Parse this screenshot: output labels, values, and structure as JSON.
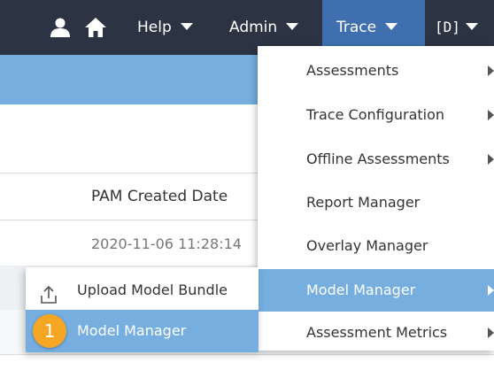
{
  "nav": {
    "icons": [
      "user-icon",
      "home-icon"
    ],
    "help_label": "Help",
    "admin_label": "Admin",
    "trace_label": "Trace",
    "user_badge": "[D]"
  },
  "table": {
    "column_header": "PAM Created Date",
    "row_value": "2020-11-06 11:28:14"
  },
  "trace_menu": {
    "items": [
      {
        "label": "Assessments",
        "has_submenu": true
      },
      {
        "label": "Trace Configuration",
        "has_submenu": true
      },
      {
        "label": "Offline Assessments",
        "has_submenu": true
      },
      {
        "label": "Report Manager",
        "has_submenu": false
      },
      {
        "label": "Overlay Manager",
        "has_submenu": false
      },
      {
        "label": "Model Manager",
        "has_submenu": true,
        "active": true
      },
      {
        "label": "Assessment Metrics",
        "has_submenu": true
      }
    ]
  },
  "model_submenu": {
    "items": [
      {
        "label": "Upload Model Bundle",
        "icon": "upload-icon"
      },
      {
        "label": "Model Manager",
        "active": true
      }
    ]
  },
  "callout_badge": "1",
  "colors": {
    "navbar": "#2c3444",
    "trace_active": "#3f6fae",
    "highlight": "#76aee0",
    "badge": "#f5a623"
  }
}
